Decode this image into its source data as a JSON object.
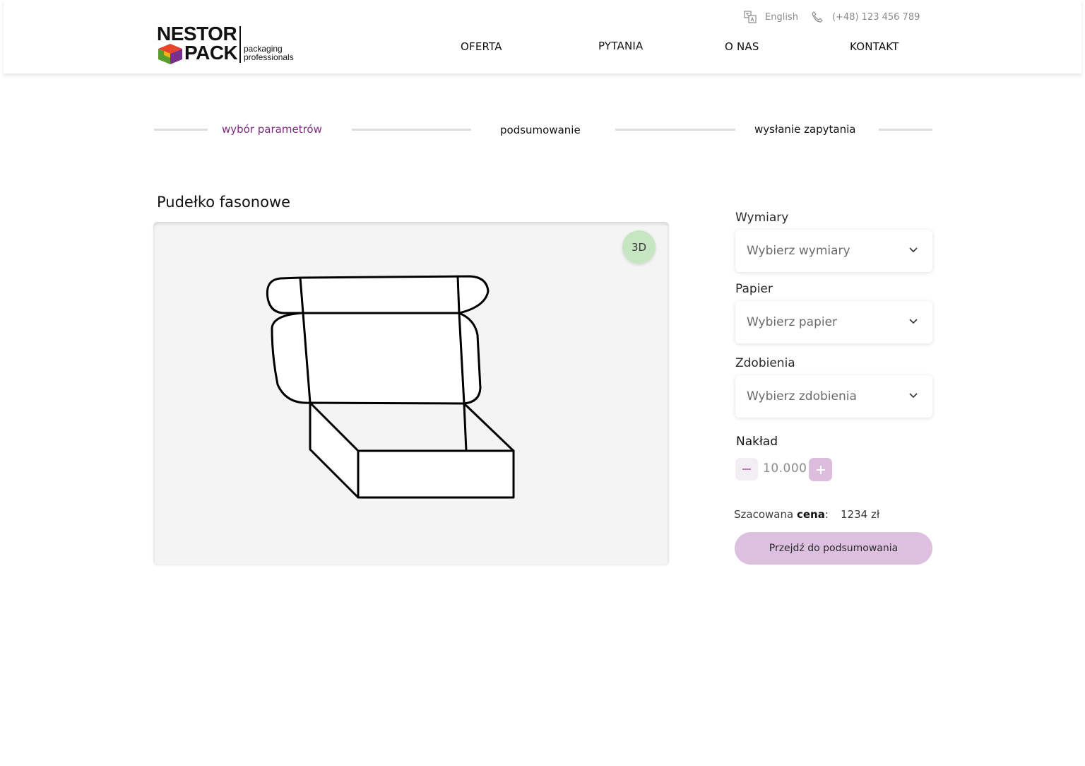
{
  "header": {
    "logo": {
      "line1": "NESTOR",
      "line2": "PACK",
      "tagline1": "packaging",
      "tagline2": "professionals"
    },
    "language_icon": "translate-icon",
    "language": "English",
    "phone_icon": "phone-icon",
    "phone": "(+48) 123 456 789",
    "nav": [
      "OFERTA",
      "PYTANIA",
      "O NAS",
      "KONTAKT"
    ]
  },
  "steps": {
    "items": [
      "wybór parametrów",
      "podsumowanie",
      "wysłanie zapytania"
    ],
    "active_index": 0,
    "active_color": "#7e2a7e"
  },
  "product": {
    "title": "Pudełko fasonowe",
    "view_3d_label": "3D"
  },
  "form": {
    "dimensions": {
      "label": "Wymiary",
      "placeholder": "Wybierz wymiary"
    },
    "paper": {
      "label": "Papier",
      "placeholder": "Wybierz papier"
    },
    "decorations": {
      "label": "Zdobienia",
      "placeholder": "Wybierz zdobienia"
    },
    "quantity": {
      "label": "Nakład",
      "value": "10.000",
      "minus_icon": "minus-icon",
      "plus_icon": "plus-icon"
    },
    "price": {
      "label_prefix": "Szacowana ",
      "label_bold": "cena",
      "label_suffix": ":",
      "value": "1234 zł"
    },
    "submit_label": "Przejdź do podsumowania"
  },
  "colors": {
    "accent": "#7e2a7e",
    "button_bg": "#ddbfdf",
    "badge_3d": "#c6e6c2"
  }
}
